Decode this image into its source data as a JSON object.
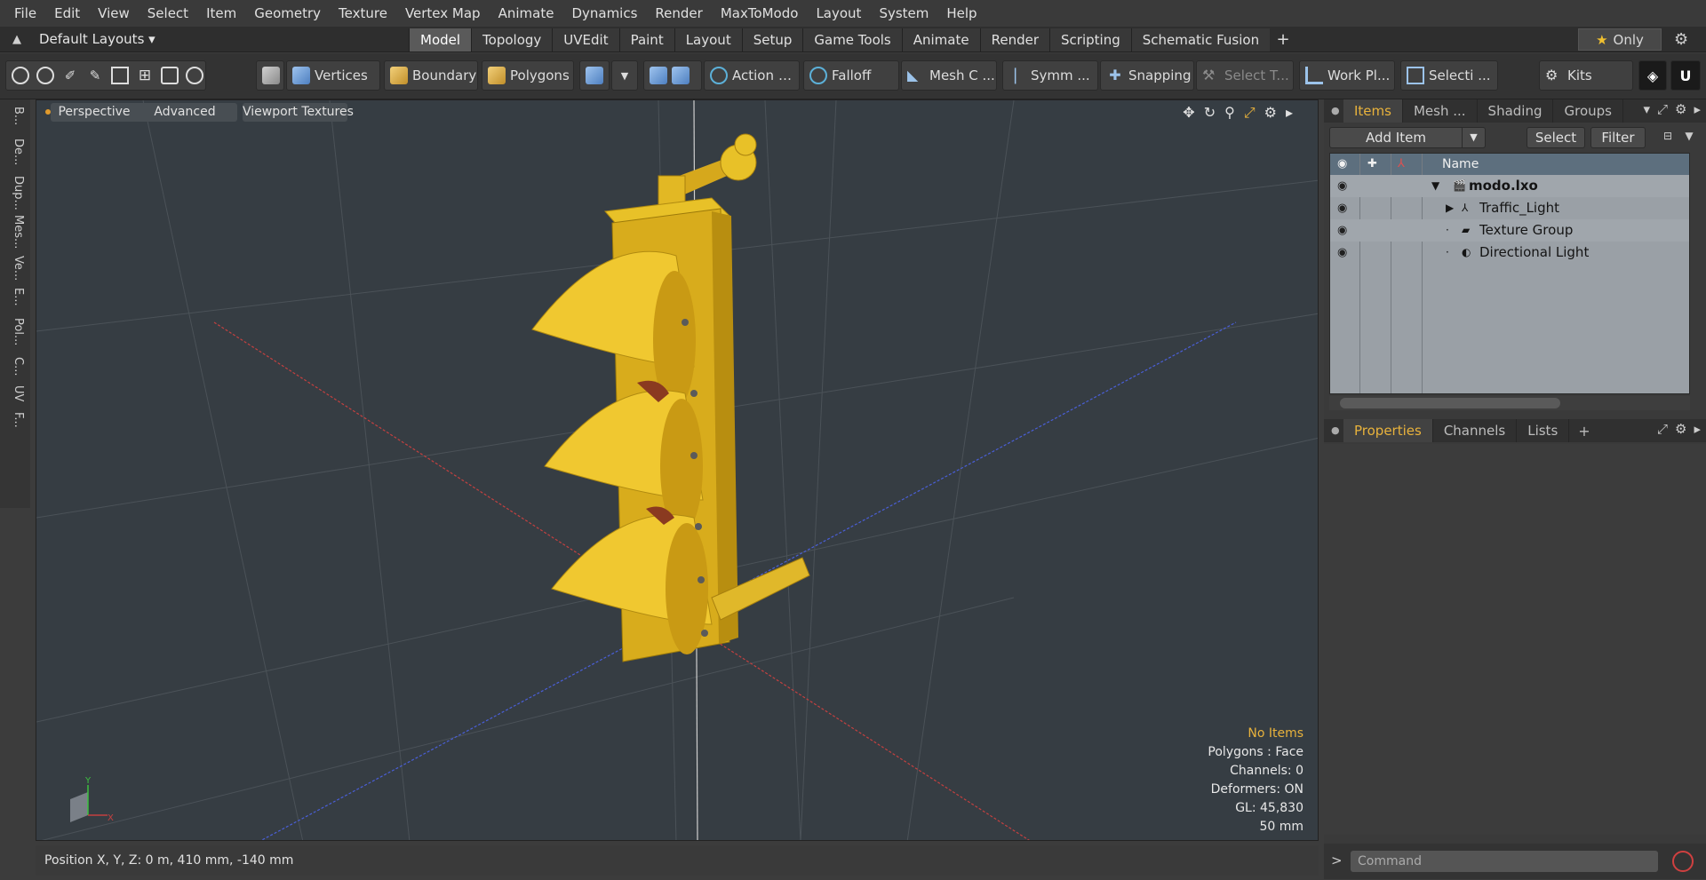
{
  "menu": [
    "File",
    "Edit",
    "View",
    "Select",
    "Item",
    "Geometry",
    "Texture",
    "Vertex Map",
    "Animate",
    "Dynamics",
    "Render",
    "MaxToModo",
    "Layout",
    "System",
    "Help"
  ],
  "layout_dropdown": "Default Layouts ▾",
  "layout_tabs": [
    "Model",
    "Topology",
    "UVEdit",
    "Paint",
    "Layout",
    "Setup",
    "Game Tools",
    "Animate",
    "Render",
    "Scripting",
    "Schematic Fusion"
  ],
  "active_layout_tab": "Model",
  "only_label": "Only",
  "toolbar": {
    "vertices": "Vertices",
    "boundary": "Boundary",
    "polygons": "Polygons",
    "action": "Action",
    "action_more": "…",
    "falloff": "Falloff",
    "mesh": "Mesh C ...",
    "symmetry": "Symm ...",
    "snapping": "Snapping",
    "select_t": "Select T...",
    "work_plane": "Work Pl...",
    "selection": "Selecti ...",
    "kits": "Kits"
  },
  "left_tabs": [
    "B...",
    "De...",
    "Dup...",
    "Mes...",
    "Ve...",
    "E...",
    "Pol...",
    "C...",
    "UV",
    "F..."
  ],
  "viewport": {
    "perspective": "Perspective",
    "advanced": "Advanced",
    "textures": "Viewport Textures",
    "info": {
      "selection": "No Items",
      "polygons": "Polygons : Face",
      "channels": "Channels: 0",
      "deformers": "Deformers: ON",
      "gl": "GL: 45,830",
      "scale": "50 mm"
    },
    "axis_labels": {
      "x": "X",
      "y": "Y",
      "z": "Z"
    }
  },
  "status": {
    "position": "Position X, Y, Z:   0 m, 410 mm, -140 mm"
  },
  "items_panel": {
    "tabs": [
      "Items",
      "Mesh ...",
      "Shading",
      "Groups"
    ],
    "active_tab": "Items",
    "add_item": "Add Item",
    "select": "Select",
    "filter": "Filter",
    "column_name": "Name",
    "tree": [
      {
        "label": "modo.lxo",
        "bold": true,
        "icon": "scene-icon",
        "indent": 0
      },
      {
        "label": "Traffic_Light",
        "bold": false,
        "icon": "locator-icon",
        "indent": 1
      },
      {
        "label": "Texture Group",
        "bold": false,
        "icon": "texture-group-icon",
        "indent": 1
      },
      {
        "label": "Directional Light",
        "bold": false,
        "icon": "light-icon",
        "indent": 1
      }
    ]
  },
  "properties_panel": {
    "tabs": [
      "Properties",
      "Channels",
      "Lists"
    ],
    "active_tab": "Properties"
  },
  "command": {
    "prompt": ">",
    "placeholder": "Command"
  },
  "colors": {
    "accent": "#e8b23c",
    "model_yellow": "#e8c128",
    "axis_x": "#c44040",
    "axis_z": "#4a5fd8"
  }
}
